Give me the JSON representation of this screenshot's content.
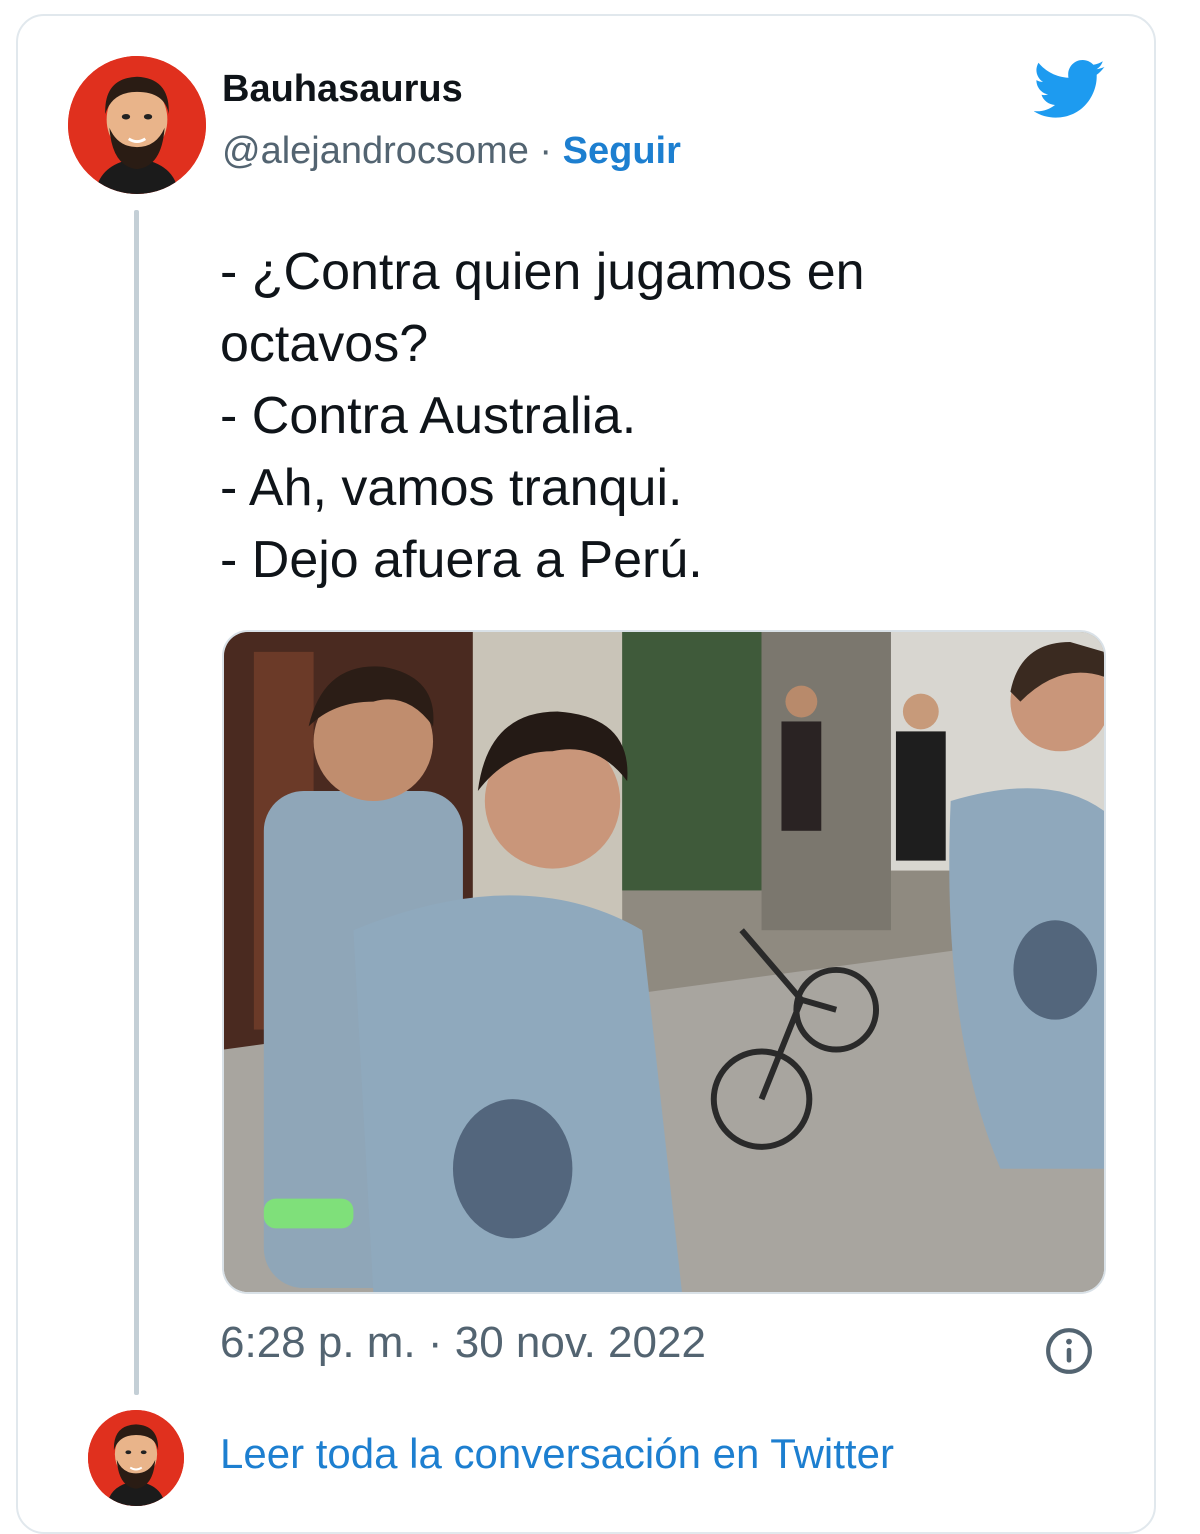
{
  "tweet": {
    "author": {
      "display_name": "Bauhasaurus",
      "handle": "@alejandrocsome",
      "separator": " · ",
      "follow_label": "Seguir"
    },
    "text_lines": [
      "- ¿Contra quien jugamos en",
      "octavos?",
      "- Contra Australia.",
      "- Ah, vamos tranqui.",
      "- Dejo afuera a Perú."
    ],
    "timestamp": "6:28 p. m. · 30 nov. 2022",
    "read_conversation_label": "Leer toda la conversación en Twitter"
  },
  "icons": {
    "brand": "twitter-bird-icon",
    "info": "info-icon"
  },
  "colors": {
    "link": "#1d7fd0",
    "brand_blue": "#1d9bf0",
    "avatar_bg": "#e0301e",
    "text": "#0f1419",
    "muted": "#536471"
  }
}
